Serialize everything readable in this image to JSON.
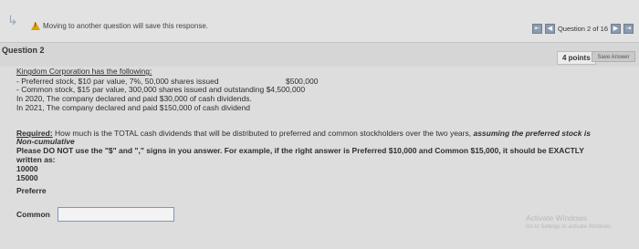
{
  "topbar": {
    "warning_text": "Moving to another question will save this response.",
    "question_nav": "Question 2 of 16"
  },
  "question": {
    "title": "Question 2",
    "points": "4 points",
    "save_label": "Save Answer"
  },
  "body": {
    "intro": "Kingdom Corporation has the following:",
    "pref_line": "- Preferred stock, $10 par value, 7%, 50,000 shares issued",
    "pref_amount": "$500,000",
    "common_line": "- Common stock, $15 par value, 300,000 shares issued and outstanding $4,500,000",
    "line_2020": "In 2020, The company declared and paid $30,000 of cash dividends.",
    "line_2021": "In 2021, The company declared and paid $150,000 of cash dividend",
    "required_label": "Required:",
    "required_text": " How much is the TOTAL cash dividends that will be distributed to preferred and common stockholders over the two years, ",
    "required_bold": "assuming the preferred stock is",
    "required_bold2": "Non-cumulative",
    "instruction_1": "Please DO NOT use the \"$\" and \",\" signs in you answer. For example, if the right answer is Preferred $10,000 and Common $15,000, it should be EXACTLY",
    "instruction_2": "written as:",
    "example_1": "10000",
    "example_2": "15000",
    "preferred_label": "Preferre",
    "common_label": "Common",
    "common_value": ""
  },
  "watermark": {
    "title": "Activate Windows",
    "subtitle": "Go to Settings to activate Windows."
  }
}
